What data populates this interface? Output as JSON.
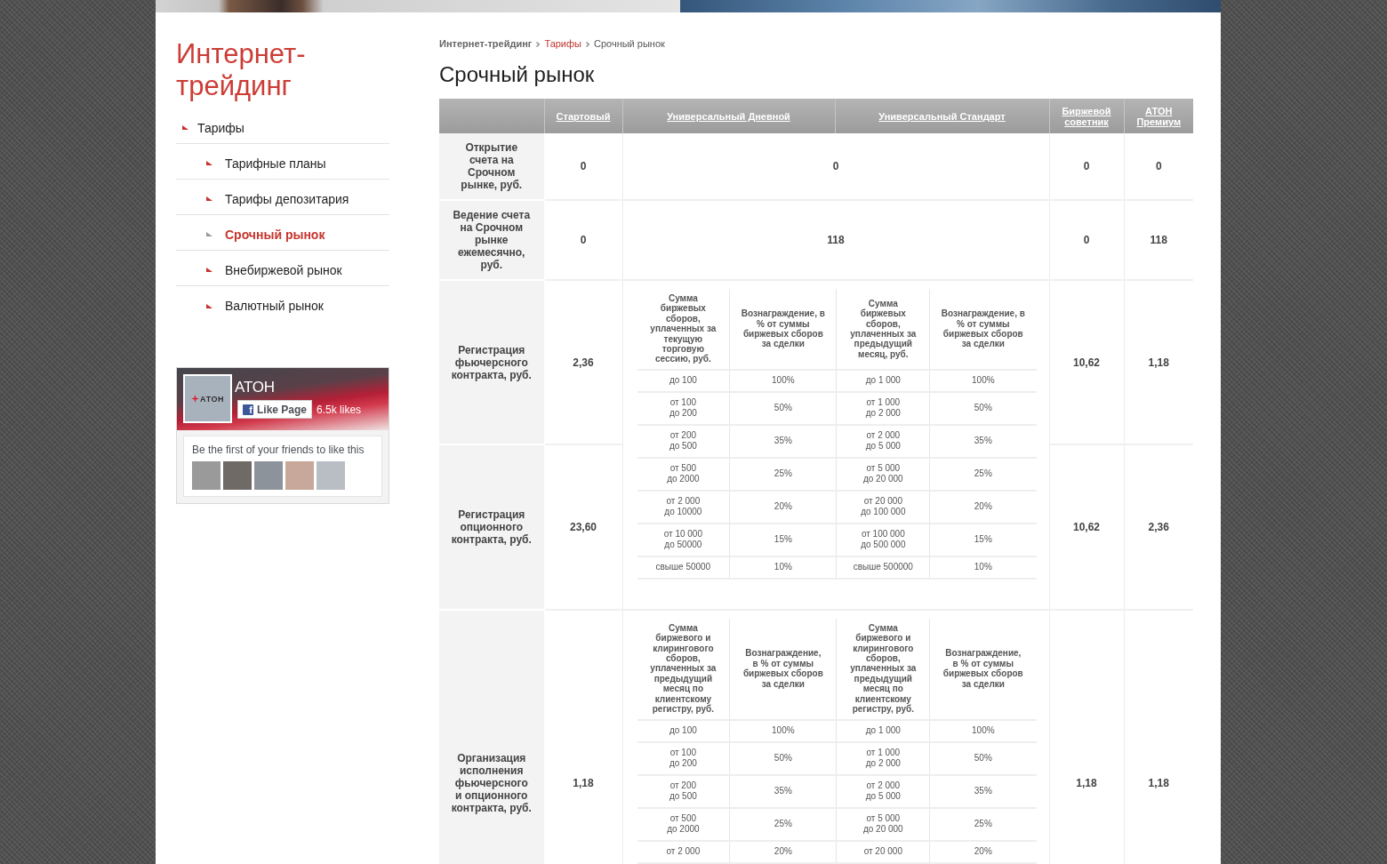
{
  "sidebar": {
    "title": "Интернет-трейдинг",
    "nav": [
      {
        "label": "Тарифы",
        "selected": false,
        "children": [
          {
            "label": "Тарифные планы",
            "selected": false
          },
          {
            "label": "Тарифы депозитария",
            "selected": false
          },
          {
            "label": "Срочный рынок",
            "selected": true
          },
          {
            "label": "Внебиржевой рынок",
            "selected": false
          },
          {
            "label": "Валютный рынок",
            "selected": false
          }
        ]
      }
    ]
  },
  "facebook_widget": {
    "logo_text": "АТОН",
    "page_name": "АТОН",
    "like_button": {
      "icon": "f",
      "label": "Like Page"
    },
    "likes": "6.5k likes",
    "friends_text": "Be the first of your friends to like this"
  },
  "breadcrumb": [
    {
      "label": "Интернет-трейдинг",
      "kind": "root"
    },
    {
      "label": "Тарифы",
      "kind": "link"
    },
    {
      "label": "Срочный рынок",
      "kind": "current"
    }
  ],
  "page_title": "Срочный рынок",
  "table": {
    "columns": [
      "Стартовый",
      "Универсальный Дневной",
      "Универсальный Стандарт",
      "Биржевой советник",
      "АТОН Премиум"
    ],
    "rows": [
      {
        "label": "Открытие\nсчета на\nСрочном\nрынке, руб.",
        "cells": [
          {
            "kind": "value",
            "value": "0"
          },
          {
            "kind": "value",
            "value": "0",
            "colspan": 2
          },
          {
            "kind": "value",
            "value": "0"
          },
          {
            "kind": "value",
            "value": "0"
          }
        ]
      },
      {
        "label": "Ведение счета\nна Срочном\nрынке\nежемесячно,\nруб.",
        "cells": [
          {
            "kind": "value",
            "value": "0"
          },
          {
            "kind": "value",
            "value": "118",
            "colspan": 2
          },
          {
            "kind": "value",
            "value": "0"
          },
          {
            "kind": "value",
            "value": "118"
          }
        ]
      },
      {
        "label": "Регистрация\nфьючерсного\nконтракта, руб.",
        "cells": [
          {
            "kind": "value",
            "value": "2,36"
          },
          {
            "kind": "tiers",
            "tiers": {
              "headers": [
                "Сумма\nбиржевых\nсборов,\nуплаченных за\nтекущую\nторговую\nсессию, руб.",
                "Вознаграждение, в\n% от суммы\nбиржевых сборов\nза сделки",
                "Сумма\nбиржевых\nсборов,\nуплаченных за\nпредыдущий\nмесяц, руб.",
                "Вознаграждение, в\n% от суммы\nбиржевых сборов\nза сделки"
              ],
              "rows": [
                [
                  "до 100",
                  "100%",
                  "до 1 000",
                  "100%"
                ],
                [
                  "от 100\nдо 200",
                  "50%",
                  "от 1 000\nдо 2 000",
                  "50%"
                ],
                [
                  "от 200\nдо 500",
                  "35%",
                  "от 2 000\nдо 5 000",
                  "35%"
                ],
                [
                  "от 500\nдо 2000",
                  "25%",
                  "от 5 000\nдо 20 000",
                  "25%"
                ],
                [
                  "от 2 000\nдо 10000",
                  "20%",
                  "от 20 000\nдо 100 000",
                  "20%"
                ],
                [
                  "от 10 000\nдо 50000",
                  "15%",
                  "от 100 000\nдо 500 000",
                  "15%"
                ],
                [
                  "свыше 50000",
                  "10%",
                  "свыше 500000",
                  "10%"
                ]
              ]
            }
          },
          {
            "kind": "covered"
          },
          {
            "kind": "value",
            "value": "10,62"
          },
          {
            "kind": "value",
            "value": "1,18"
          }
        ]
      },
      {
        "label": "Регистрация\nопционного\nконтракта, руб.",
        "cells": [
          {
            "kind": "value",
            "value": "23,60"
          },
          {
            "kind": "covered"
          },
          {
            "kind": "covered"
          },
          {
            "kind": "value",
            "value": "10,62"
          },
          {
            "kind": "value",
            "value": "2,36"
          }
        ]
      },
      {
        "label": "Организация\nисполнения\nфьючерсного\nи опционного\nконтракта, руб.",
        "cells": [
          {
            "kind": "value",
            "value": "1,18"
          },
          {
            "kind": "tiers",
            "tiers": {
              "headers": [
                "Сумма\nбиржевого и\nклирингового\nсборов,\nуплаченных за\nпредыдущий\nмесяц по\nклиентскому\nрегистру, руб.",
                "Вознаграждение,\nв % от суммы\nбиржевых сборов\nза сделки",
                "Сумма\nбиржевого и\nклирингового\nсборов,\nуплаченных за\nпредыдущий\nмесяц по\nклиентскому\nрегистру, руб.",
                "Вознаграждение,\nв % от суммы\nбиржевых сборов\nза сделки"
              ],
              "rows": [
                [
                  "до 100",
                  "100%",
                  "до 1 000",
                  "100%"
                ],
                [
                  "от 100\nдо 200",
                  "50%",
                  "от 1 000\nдо 2 000",
                  "50%"
                ],
                [
                  "от 200\nдо 500",
                  "35%",
                  "от 2 000\nдо 5 000",
                  "35%"
                ],
                [
                  "от 500\nдо 2000",
                  "25%",
                  "от 5 000\nдо 20 000",
                  "25%"
                ],
                [
                  "от 2 000",
                  "20%",
                  "от 20 000",
                  "20%"
                ]
              ]
            }
          },
          {
            "kind": "covered"
          },
          {
            "kind": "value",
            "value": "1,18"
          },
          {
            "kind": "value",
            "value": "1,18"
          }
        ]
      }
    ]
  }
}
